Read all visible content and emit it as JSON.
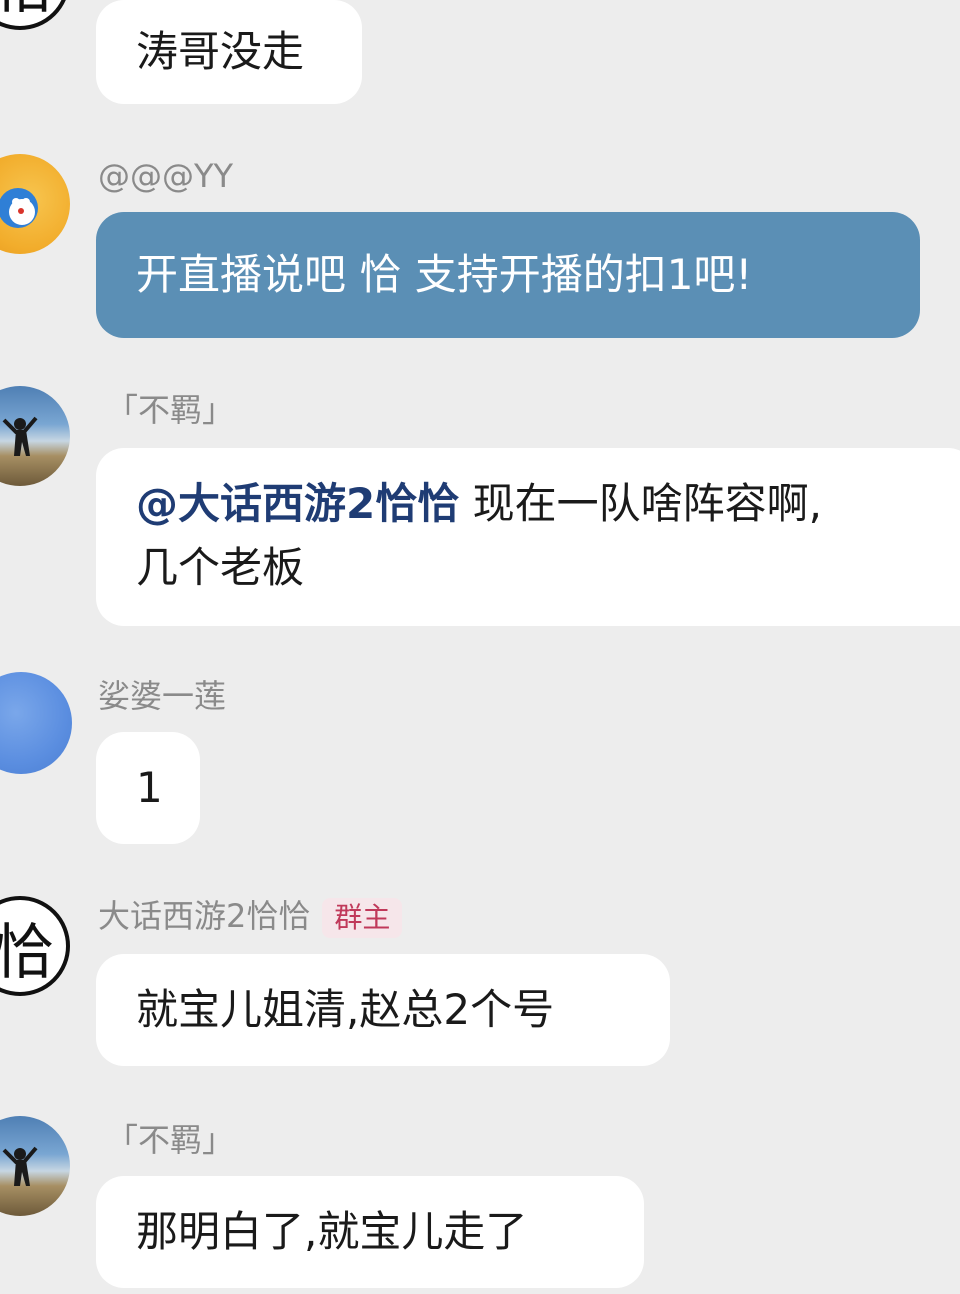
{
  "messages": [
    {
      "sender": "",
      "text": "涛哥没走",
      "avatar": "text-avatar-partial"
    },
    {
      "sender": "@@@YY",
      "text": "开直播说吧  恰   支持开播的扣1吧!",
      "avatar": "doraemon-avatar",
      "highlight_color": "#5b8fb5"
    },
    {
      "sender": "「不羁」",
      "mention": "@大话西游2恰恰",
      "text_line1": " 现在一队啥阵容啊,",
      "text_line2": "几个老板",
      "avatar": "landscape-avatar"
    },
    {
      "sender": "娑婆一莲",
      "text": "1",
      "avatar": "blue-avatar"
    },
    {
      "sender": "大话西游2恰恰",
      "badge": "群主",
      "text": "就宝儿姐清,赵总2个号",
      "avatar": "text-avatar",
      "avatar_text": "恰"
    },
    {
      "sender": "「不羁」",
      "text": "那明白了,就宝儿走了",
      "avatar": "landscape-avatar"
    }
  ],
  "colors": {
    "background": "#ededed",
    "bubble": "#ffffff",
    "highlight_bubble": "#5b8fb5",
    "mention": "#1f3c74",
    "badge_text": "#c0395a",
    "sender_text": "#8a8a8a"
  }
}
